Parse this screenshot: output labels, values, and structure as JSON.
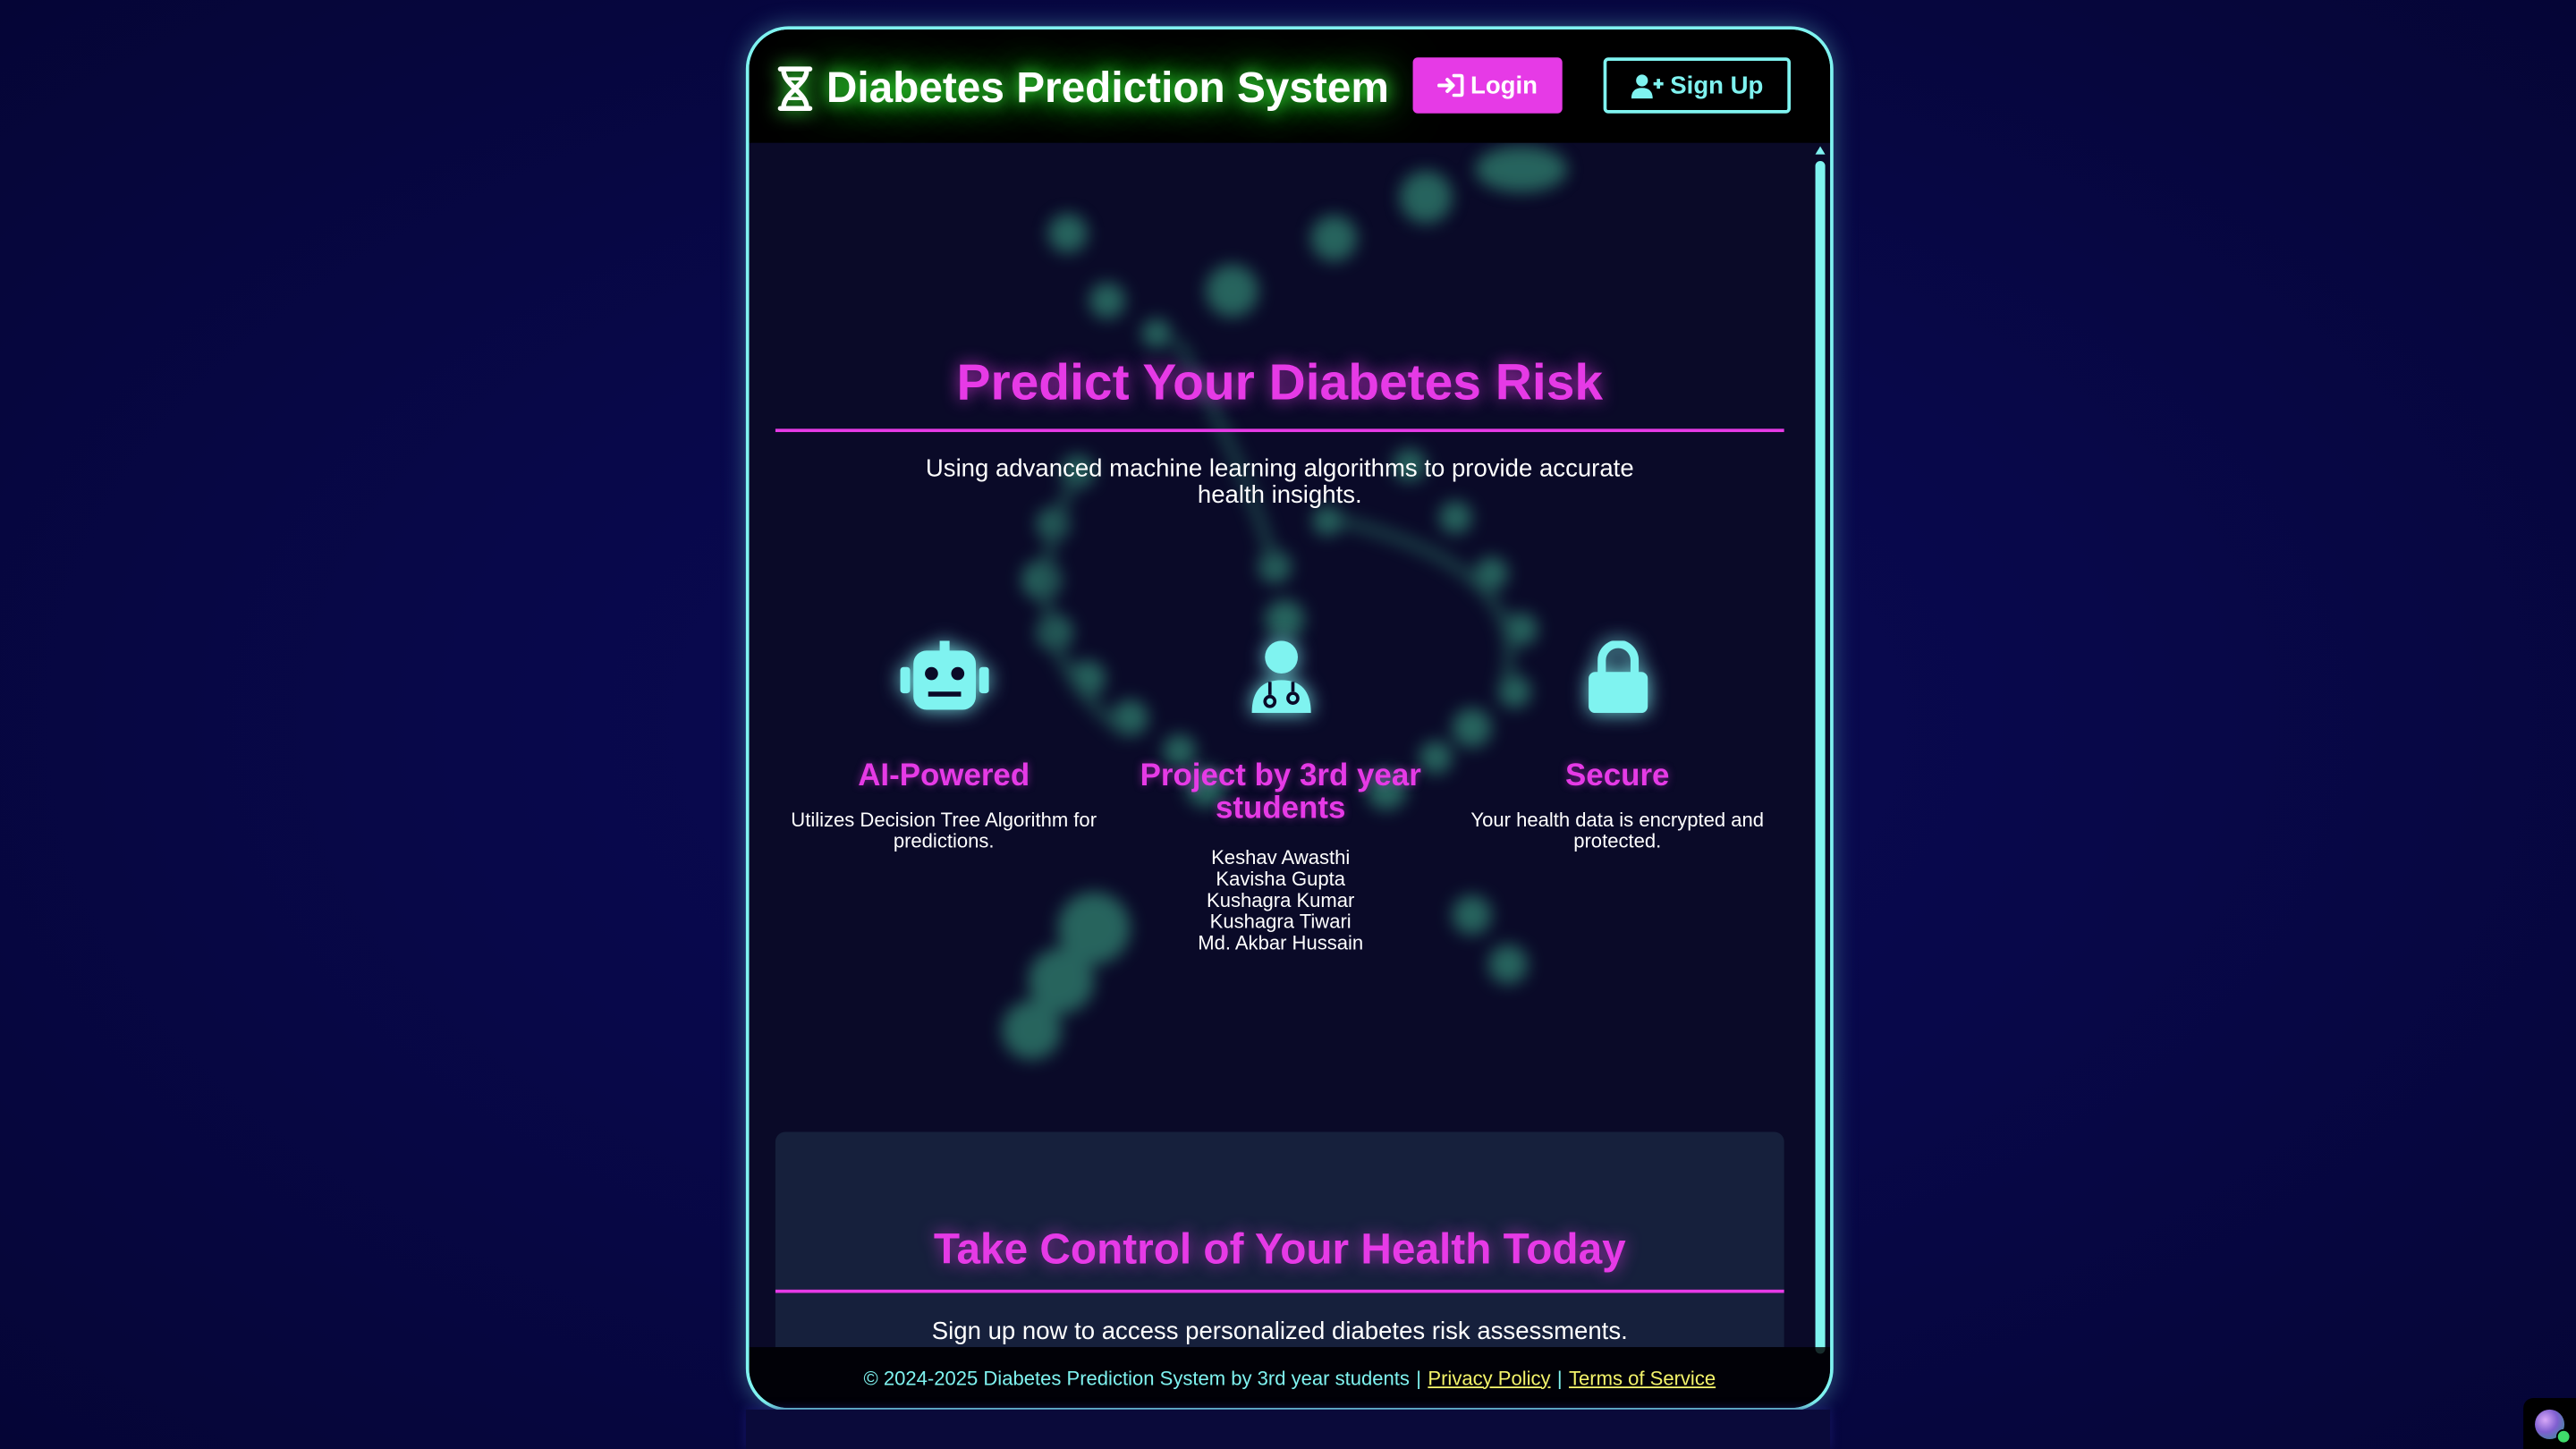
{
  "header": {
    "brand_icon": "dna-icon",
    "title": "Diabetes Prediction System",
    "login_label": "Login",
    "login_icon": "sign-in-icon",
    "signup_label": "Sign Up",
    "signup_icon": "user-plus-icon"
  },
  "hero": {
    "title": "Predict Your Diabetes Risk",
    "subtitle": "Using advanced machine learning algorithms to provide accurate health insights."
  },
  "features": [
    {
      "icon": "robot-icon",
      "title": "AI-Powered",
      "description": "Utilizes Decision Tree Algorithm for predictions."
    },
    {
      "icon": "doctor-icon",
      "title": "Project by 3rd year students",
      "team": [
        "Keshav Awasthi",
        "Kavisha Gupta",
        "Kushagra Kumar",
        "Kushagra Tiwari",
        "Md. Akbar Hussain"
      ]
    },
    {
      "icon": "lock-icon",
      "title": "Secure",
      "description": "Your health data is encrypted and protected."
    }
  ],
  "cta": {
    "title": "Take Control of Your Health Today",
    "subtitle": "Sign up now to access personalized diabetes risk assessments."
  },
  "footer": {
    "copyright": "© 2024-2025 Diabetes Prediction System by 3rd year students",
    "separator": "|",
    "privacy_label": "Privacy Policy",
    "terms_label": "Terms of Service"
  },
  "colors": {
    "accent_magenta": "#e63ae6",
    "accent_cyan": "#7ff3f0",
    "glow_green": "#3cff3c",
    "link_yellow": "#f4f46a",
    "page_bg": "#08084a",
    "panel_bg": "#0a0a28"
  }
}
